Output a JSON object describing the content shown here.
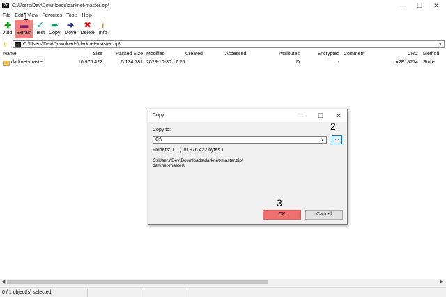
{
  "window": {
    "title": "C:\\Users\\Dev\\Downloads\\darknet-master.zip\\",
    "icon_label": "7z",
    "minimize_icon": "minimize-icon",
    "maximize_icon": "maximize-icon",
    "close_icon": "close-icon"
  },
  "menu": [
    "File",
    "Edit",
    "View",
    "Favorites",
    "Tools",
    "Help"
  ],
  "toolbar": {
    "add": "Add",
    "extract": "Extract",
    "test": "Test",
    "copy": "Copy",
    "move": "Move",
    "delete": "Delete",
    "info": "Info",
    "active_color": "#f08080"
  },
  "address": {
    "path": "C:\\Users\\Dev\\Downloads\\darknet-master.zip\\"
  },
  "columns": {
    "name": "Name",
    "size": "Size",
    "packed_size": "Packed Size",
    "modified": "Modified",
    "created": "Created",
    "accessed": "Accessed",
    "attributes": "Attributes",
    "encrypted": "Encrypted",
    "comment": "Comment",
    "crc": "CRC",
    "method": "Method"
  },
  "rows": [
    {
      "name": "darknet-master",
      "size": "10 976 422",
      "packed_size": "5 134 781",
      "modified": "2023-10-30 17:26",
      "attributes": "D",
      "encrypted": "-",
      "crc": "A2E18274",
      "method": "Store"
    }
  ],
  "status": {
    "text": "0 / 1 object(s) selected"
  },
  "dialog": {
    "title": "Copy",
    "copy_to_label": "Copy to:",
    "copy_to_value": "C:\\",
    "browse_label": "...",
    "folders_info": "Folders: 1    ( 10 976 422 bytes )",
    "source_path_line1": "C:\\Users\\Dev\\Downloads\\darknet-master.zip\\",
    "source_path_line2": "  darknet-master\\",
    "ok_label": "OK",
    "cancel_label": "Cancel",
    "highlight_color": "#f07070"
  },
  "steps": {
    "one": "1",
    "two": "2",
    "three": "3"
  }
}
